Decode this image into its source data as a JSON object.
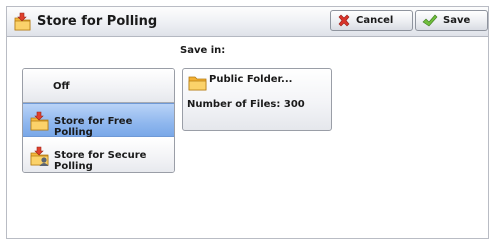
{
  "header": {
    "title": "Store for Polling",
    "cancel_label": "Cancel",
    "save_label": "Save"
  },
  "save_in": {
    "label": "Save in:",
    "folder_name": "Public Folder...",
    "files_text": "Number of Files: 300"
  },
  "options": [
    {
      "label": "Off",
      "selected": false
    },
    {
      "label": "Store for Free Polling",
      "selected": true
    },
    {
      "label": "Store for Secure Polling",
      "selected": false
    }
  ],
  "colors": {
    "selected_fill": "#8fb7ee",
    "cancel_icon": "#d9342b",
    "save_icon": "#5aa832",
    "folder": "#f3b033"
  }
}
